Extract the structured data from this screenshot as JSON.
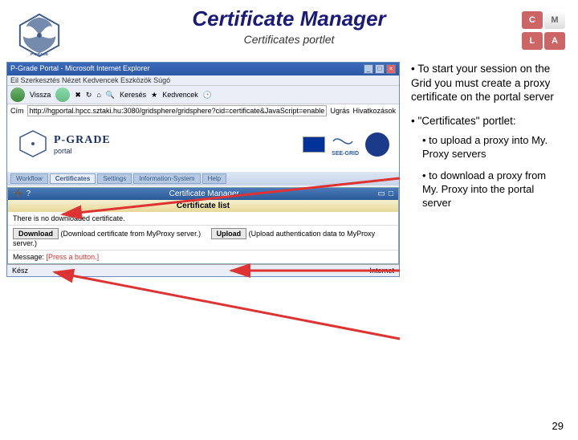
{
  "slide": {
    "title": "Certificate Manager",
    "subtitle": "Certificates portlet",
    "number": "29"
  },
  "puzzle": {
    "c": "C",
    "m": "M",
    "l": "L",
    "a": "A"
  },
  "ie": {
    "title": "P-Grade Portal - Microsoft Internet Explorer",
    "menubar": "Eil  Szerkesztés  Nézet  Kedvencek  Eszközök  Súgó",
    "back": "Vissza",
    "forward": "",
    "search_label": "Keresés",
    "fav_label": "Kedvencek",
    "addr_label": "Cím",
    "url": "http://hgportal.hpcc.sztaki.hu:3080/gridsphere/gridsphere?cid=certificate&JavaScript=enabled",
    "go": "Ugrás",
    "links": "Hivatkozások",
    "status": "Kész",
    "zone": "Internet"
  },
  "pgrade": {
    "text": "P-GRADE",
    "portal": "portal",
    "seegrid": "SEE-GRID"
  },
  "tabs": [
    "Workflow",
    "Certificates",
    "Settings",
    "Information-System",
    "Help"
  ],
  "portlet": {
    "title": "Certificate Manager",
    "list_header": "Certificate list",
    "no_cert": "There is no downloaded certificate.",
    "download_btn": "Download",
    "download_text": "(Download certificate from MyProxy server.)",
    "upload_btn": "Upload",
    "upload_text": "(Upload authentication data to MyProxy server.)",
    "msg_label": "Message:",
    "msg_value": "[Press a button.]"
  },
  "bullets": {
    "b1": "To start your session on the Grid you must create a proxy certificate on the portal server",
    "b2": "\"Certificates\" portlet:",
    "sub1": "to upload a proxy into My. Proxy servers",
    "sub2": "to download a proxy from My. Proxy into the portal server"
  }
}
